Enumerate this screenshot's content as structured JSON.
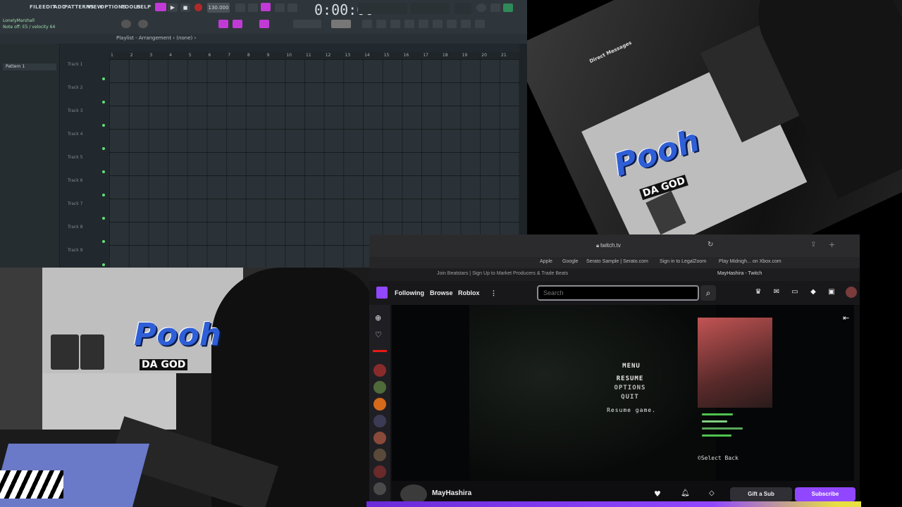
{
  "fl_studio": {
    "menu": [
      "FILE",
      "EDIT",
      "ADD",
      "PATTERNS",
      "VIEW",
      "OPTIONS",
      "TOOLS",
      "HELP"
    ],
    "tempo": "130.000",
    "time": "0:00:00",
    "hint_line1": "LonelyMarshall",
    "hint_line2": "Note off: E5 / velocity 64",
    "playlist_title": "Playlist - Arrangement › (none) ›",
    "pattern": "Pattern 1",
    "tracks": [
      "Track 1",
      "Track 2",
      "Track 3",
      "Track 4",
      "Track 5",
      "Track 6",
      "Track 7",
      "Track 8",
      "Track 9"
    ],
    "ruler": [
      "1",
      "2",
      "3",
      "4",
      "5",
      "6",
      "7",
      "8",
      "9",
      "10",
      "11",
      "12",
      "13",
      "14",
      "15",
      "16",
      "17",
      "18",
      "19",
      "20",
      "21"
    ]
  },
  "webcam_top": {
    "dm_label": "Direct Messages",
    "logo": "Pooh",
    "logo_sub": "DA GOD"
  },
  "webcam_bottom": {
    "logo": "Pooh",
    "logo_sub": "DA GOD"
  },
  "browser": {
    "url": "twitch.tv",
    "bookmarks": [
      "Apple",
      "Google",
      "Serato Sample | Serato.com",
      "Sign in to LegalZoom",
      "Play Midnigh... on Xbox.com"
    ],
    "tabs": [
      "Join Beatstars | Sign Up to Market Producers & Trade Beats",
      "MayHashira - Twitch"
    ]
  },
  "twitch": {
    "nav": [
      "Following",
      "Browse",
      "Roblox"
    ],
    "search_placeholder": "Search",
    "game_menu": {
      "title": "MENU",
      "items": [
        "RESUME",
        "OPTIONS",
        "QUIT"
      ],
      "hint": "Resume game."
    },
    "overlay_bottom": "©Select  Back",
    "streamer": "MayHashira",
    "gift": "Gift a Sub",
    "subscribe": "Subscribe",
    "colors": {
      "accent": "#9147ff",
      "nav_bg": "#18181b"
    }
  }
}
